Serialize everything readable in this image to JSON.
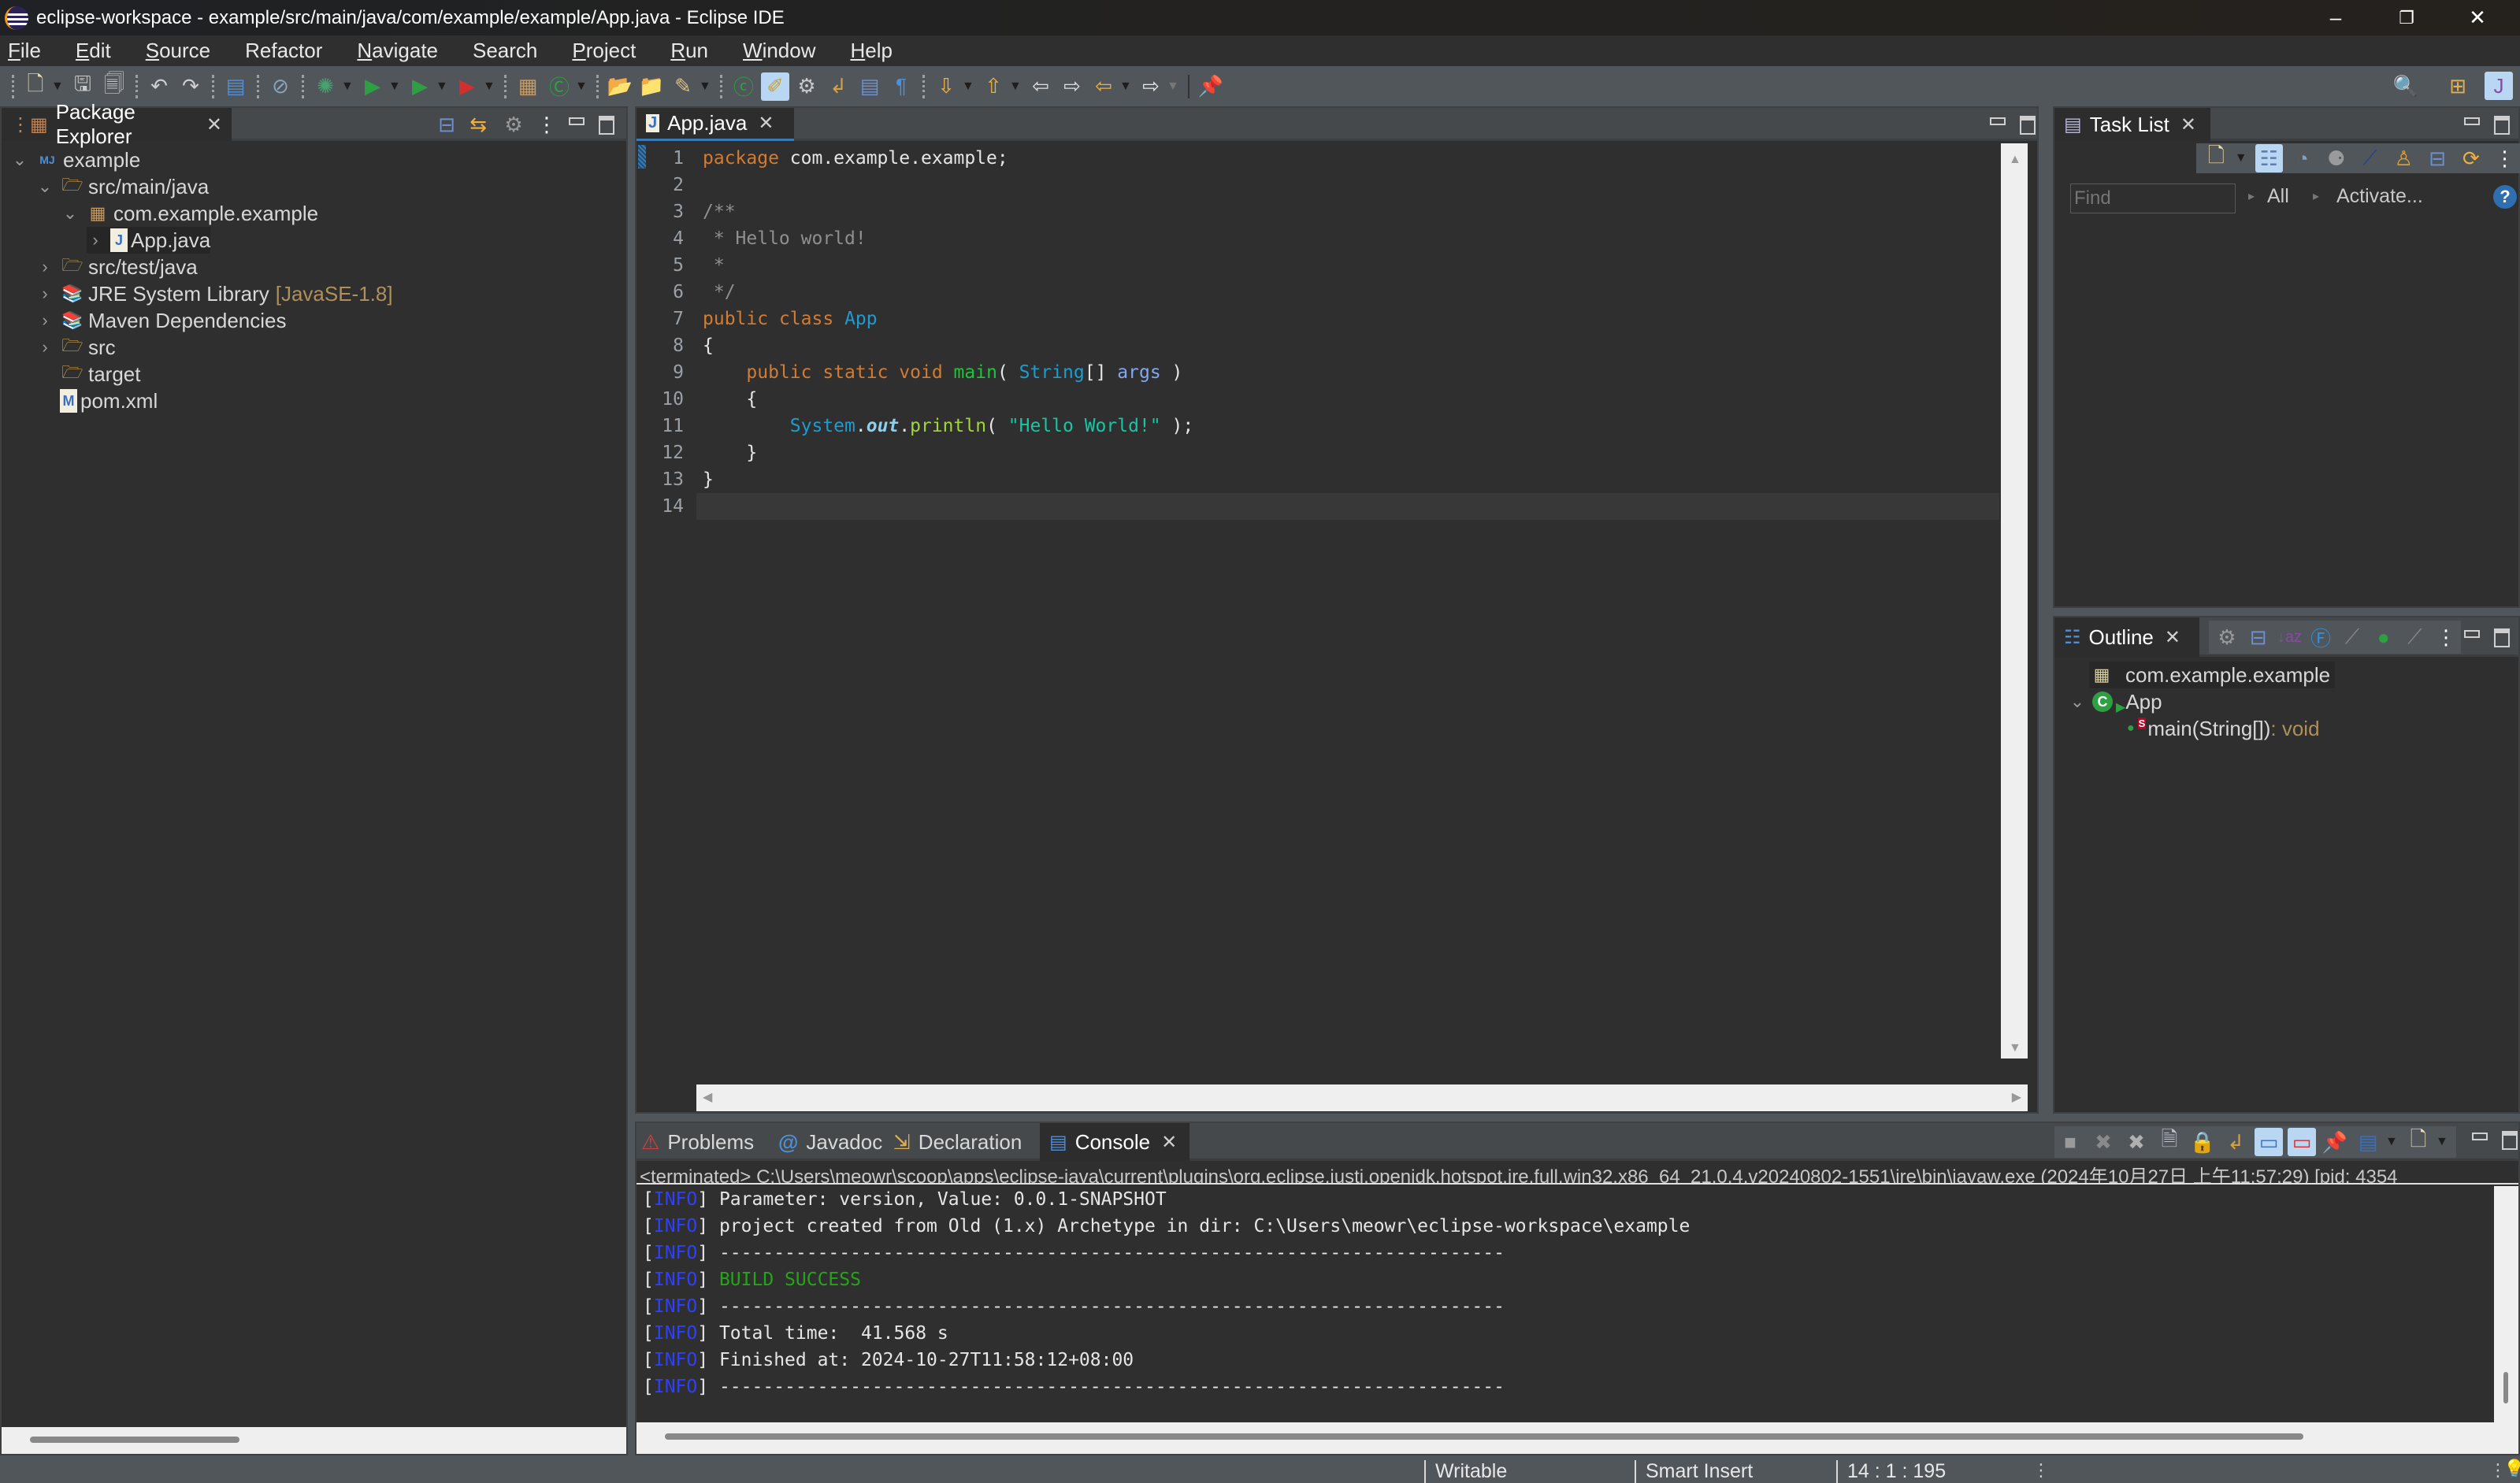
{
  "window": {
    "title": "eclipse-workspace - example/src/main/java/com/example/example/App.java - Eclipse IDE",
    "controls": {
      "minimize": "–",
      "restore": "❐",
      "close": "✕"
    }
  },
  "menu": [
    {
      "label": "File",
      "mnemonic": "F",
      "rest": "ile"
    },
    {
      "label": "Edit",
      "mnemonic": "E",
      "rest": "dit"
    },
    {
      "label": "Source",
      "mnemonic": "S",
      "rest": "ource"
    },
    {
      "label": "Refactor",
      "mnemonic": "",
      "rest": "Refactor"
    },
    {
      "label": "Navigate",
      "mnemonic": "N",
      "rest": "avigate"
    },
    {
      "label": "Search",
      "mnemonic": "",
      "rest": "Search"
    },
    {
      "label": "Project",
      "mnemonic": "P",
      "rest": "roject"
    },
    {
      "label": "Run",
      "mnemonic": "R",
      "rest": "un"
    },
    {
      "label": "Window",
      "mnemonic": "W",
      "rest": "indow"
    },
    {
      "label": "Help",
      "mnemonic": "H",
      "rest": "elp"
    }
  ],
  "toolbar": {
    "icons": [
      "new-icon",
      "save-icon",
      "save-all-icon",
      "undo-icon",
      "redo-icon",
      "terminal-icon",
      "skip-breakpoints-icon",
      "debug-icon",
      "run-icon",
      "coverage-icon",
      "run-external-tools-icon",
      "new-java-package-icon",
      "new-java-class-icon",
      "open-type-icon",
      "open-task-icon",
      "search-icon",
      "open-console-icon",
      "toggle-mark-occurrences-icon",
      "toggle-breadcrumb-icon",
      "toggle-word-wrap-icon",
      "toggle-block-selection-icon",
      "show-whitespace-icon",
      "next-annotation-icon",
      "previous-annotation-icon",
      "last-edit-location-icon",
      "back-icon",
      "forward-icon",
      "pin-editor-icon"
    ],
    "right_icons": [
      "quick-access-search-icon",
      "open-perspective-icon",
      "java-perspective-icon"
    ]
  },
  "package_explorer": {
    "tab_label": "Package Explorer",
    "tree": [
      {
        "label": "example",
        "depth": 0,
        "expanded": true,
        "icon": "maven-project-icon"
      },
      {
        "label": "src/main/java",
        "depth": 1,
        "expanded": true,
        "icon": "source-folder-icon"
      },
      {
        "label": "com.example.example",
        "depth": 2,
        "expanded": true,
        "icon": "package-icon"
      },
      {
        "label": "App.java",
        "depth": 3,
        "expanded": false,
        "icon": "java-file-icon"
      },
      {
        "label": "src/test/java",
        "depth": 1,
        "expanded": false,
        "icon": "test-source-folder-icon"
      },
      {
        "label": "JRE System Library",
        "decoration": "[JavaSE-1.8]",
        "depth": 1,
        "expanded": false,
        "icon": "library-icon"
      },
      {
        "label": "Maven Dependencies",
        "depth": 1,
        "expanded": false,
        "icon": "library-icon"
      },
      {
        "label": "src",
        "depth": 1,
        "expanded": false,
        "icon": "folder-icon"
      },
      {
        "label": "target",
        "depth": 1,
        "leaf": true,
        "icon": "folder-icon"
      },
      {
        "label": "pom.xml",
        "depth": 1,
        "leaf": true,
        "icon": "pom-file-icon"
      }
    ]
  },
  "editor": {
    "tab_label": "App.java",
    "current_line": 14,
    "lines": [
      {
        "n": "1",
        "tokens": [
          [
            "k",
            "package"
          ],
          [
            "pl",
            " com.example.example;"
          ]
        ]
      },
      {
        "n": "2",
        "tokens": []
      },
      {
        "n": "3",
        "fold": true,
        "tokens": [
          [
            "c",
            "/**"
          ]
        ]
      },
      {
        "n": "4",
        "tokens": [
          [
            "c",
            " * Hello world!"
          ]
        ]
      },
      {
        "n": "5",
        "tokens": [
          [
            "c",
            " *"
          ]
        ]
      },
      {
        "n": "6",
        "tokens": [
          [
            "c",
            " */"
          ]
        ]
      },
      {
        "n": "7",
        "tokens": [
          [
            "k",
            "public"
          ],
          [
            "pl",
            " "
          ],
          [
            "k",
            "class"
          ],
          [
            "pl",
            " "
          ],
          [
            "t",
            "App"
          ]
        ]
      },
      {
        "n": "8",
        "tokens": [
          [
            "pl",
            "{"
          ]
        ]
      },
      {
        "n": "9",
        "fold": true,
        "tokens": [
          [
            "pl",
            "    "
          ],
          [
            "k",
            "public"
          ],
          [
            "pl",
            " "
          ],
          [
            "k",
            "static"
          ],
          [
            "pl",
            " "
          ],
          [
            "k",
            "void"
          ],
          [
            "pl",
            " "
          ],
          [
            "m",
            "main"
          ],
          [
            "pl",
            "( "
          ],
          [
            "t",
            "String"
          ],
          [
            "pl",
            "[] "
          ],
          [
            "p",
            "args"
          ],
          [
            "pl",
            " )"
          ]
        ]
      },
      {
        "n": "10",
        "tokens": [
          [
            "pl",
            "    {"
          ]
        ]
      },
      {
        "n": "11",
        "tokens": [
          [
            "pl",
            "        "
          ],
          [
            "t",
            "System"
          ],
          [
            "pl",
            "."
          ],
          [
            "f",
            "out"
          ],
          [
            "pl",
            "."
          ],
          [
            "me",
            "println"
          ],
          [
            "pl",
            "( "
          ],
          [
            "s",
            "\"Hello World!\""
          ],
          [
            "pl",
            " );"
          ]
        ]
      },
      {
        "n": "12",
        "tokens": [
          [
            "pl",
            "    }"
          ]
        ]
      },
      {
        "n": "13",
        "tokens": [
          [
            "pl",
            "}"
          ]
        ]
      },
      {
        "n": "14",
        "tokens": []
      }
    ]
  },
  "task_list": {
    "tab_label": "Task List",
    "find_placeholder": "Find",
    "filter_all": "All",
    "activate": "Activate..."
  },
  "outline": {
    "tab_label": "Outline",
    "items": [
      {
        "label": "com.example.example",
        "icon": "package-declaration-icon"
      },
      {
        "label": "App",
        "icon": "class-icon"
      },
      {
        "label": "main(String[])",
        "type": " : void",
        "icon": "public-method-icon"
      }
    ]
  },
  "bottom_panel": {
    "tabs": [
      {
        "label": "Problems",
        "icon": "problems-icon",
        "active": false
      },
      {
        "label": "Javadoc",
        "icon": "javadoc-icon",
        "active": false
      },
      {
        "label": "Declaration",
        "icon": "declaration-icon",
        "active": false
      },
      {
        "label": "Console",
        "icon": "console-icon",
        "active": true
      }
    ],
    "console_header": "<terminated> C:\\Users\\meowr\\scoop\\apps\\eclipse-java\\current\\plugins\\org.eclipse.justj.openjdk.hotspot.jre.full.win32.x86_64_21.0.4.v20240802-1551\\jre\\bin\\javaw.exe  (2024年10月27日 上午11:57:29) [pid: 4354",
    "console_lines": [
      {
        "tag": "INFO",
        "text": "Parameter: version, Value: 0.0.1-SNAPSHOT",
        "style": "pl"
      },
      {
        "tag": "INFO",
        "text": "project created from Old (1.x) Archetype in dir: C:\\Users\\meowr\\eclipse-workspace\\example",
        "style": "pl"
      },
      {
        "tag": "INFO",
        "text": "------------------------------------------------------------------------",
        "style": "pl"
      },
      {
        "tag": "INFO",
        "text": "BUILD SUCCESS",
        "style": "ok"
      },
      {
        "tag": "INFO",
        "text": "------------------------------------------------------------------------",
        "style": "pl"
      },
      {
        "tag": "INFO",
        "text": "Total time:  41.568 s",
        "style": "pl"
      },
      {
        "tag": "INFO",
        "text": "Finished at: 2024-10-27T11:58:12+08:00",
        "style": "pl"
      },
      {
        "tag": "INFO",
        "text": "------------------------------------------------------------------------",
        "style": "pl"
      }
    ]
  },
  "status_bar": {
    "writable": "Writable",
    "insert_mode": "Smart Insert",
    "position": "14 : 1 : 195"
  }
}
